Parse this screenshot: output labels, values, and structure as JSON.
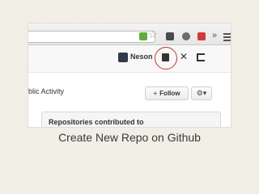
{
  "header": {
    "username": "Neson"
  },
  "profile": {
    "activity_label": "blic Activity",
    "follow_label": "Follow",
    "follow_icon": "person-plus-icon",
    "settings_icon": "gear-icon"
  },
  "repos": {
    "title": "Repositories contributed to"
  },
  "caption": "Create New Repo on Github",
  "icons": {
    "star": "☆",
    "chevron": "»",
    "tools": "✕",
    "gear": "⚙▾",
    "follow": "+"
  },
  "colors": {
    "highlight_ring": "#c0392b",
    "background": "#f1eee6"
  }
}
